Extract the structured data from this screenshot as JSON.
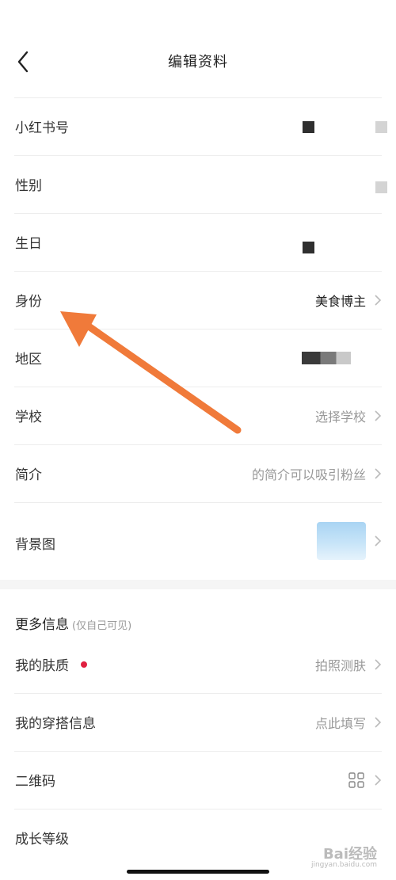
{
  "nav": {
    "title": "编辑资料"
  },
  "rows": [
    {
      "label": "小红书号"
    },
    {
      "label": "性别"
    },
    {
      "label": "生日"
    },
    {
      "label": "身份",
      "value": "美食博主"
    },
    {
      "label": "地区"
    },
    {
      "label": "学校",
      "value": "选择学校"
    },
    {
      "label": "简介",
      "value": "的简介可以吸引粉丝"
    },
    {
      "label": "背景图"
    }
  ],
  "more": {
    "header": "更多信息",
    "subtitle": "(仅自己可见)",
    "rows": [
      {
        "label": "我的肤质",
        "value": "拍照测肤"
      },
      {
        "label": "我的穿搭信息",
        "value": "点此填写"
      },
      {
        "label": "二维码"
      },
      {
        "label": "成长等级"
      }
    ]
  },
  "watermark": {
    "text": "Bai经验",
    "sub": "jingyan.baidu.com"
  },
  "colors": {
    "accent_dot": "#e02040",
    "arrow": "#f07a3a"
  }
}
